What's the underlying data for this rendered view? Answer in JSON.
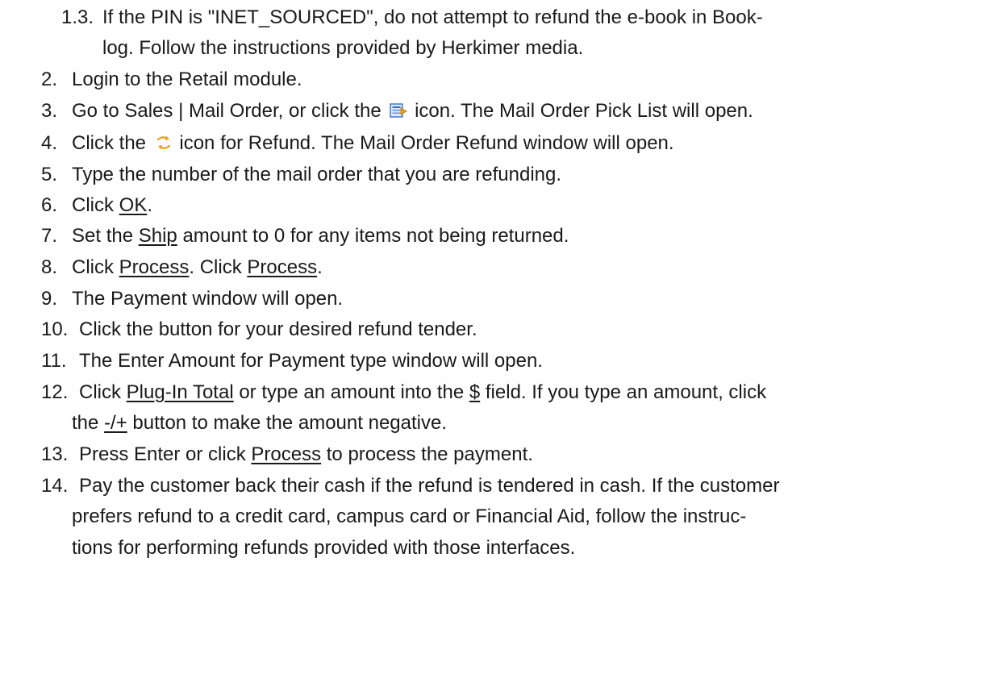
{
  "steps": {
    "s1_3": {
      "number": "1.3.",
      "line1": "If the PIN is \"INET_SOURCED\", do not attempt to refund the e-book in Book-",
      "line2": "log. Follow the instructions provided by Herkimer media."
    },
    "s2": {
      "number": "2.",
      "text": "Login to the Retail module."
    },
    "s3": {
      "number": "3.",
      "before": "Go to Sales | Mail Order, or click the",
      "after": "icon. The Mail Order Pick List will open.",
      "icon": "mail-order-icon"
    },
    "s4": {
      "number": "4.",
      "before": "Click the",
      "after": "icon for Refund. The Mail Order Refund window will open.",
      "icon": "refund-icon"
    },
    "s5": {
      "number": "5.",
      "text": "Type the number of the mail order that you are refunding."
    },
    "s6": {
      "number": "6.",
      "before": "Click",
      "link": "OK",
      "after": "."
    },
    "s7": {
      "number": "7.",
      "before": "Set the",
      "link": "Ship",
      "after": "amount to 0 for any items not being returned."
    },
    "s8": {
      "number": "8.",
      "before": "Click",
      "link1": "Process",
      "middle": ". Click",
      "link2": "Process",
      "after": "."
    },
    "s9": {
      "number": "9.",
      "text": "The Payment window will open."
    },
    "s10": {
      "number": "10.",
      "text": "Click the button for your desired refund tender."
    },
    "s11": {
      "number": "11.",
      "text": "The Enter Amount for Payment type window will open."
    },
    "s12": {
      "number": "12.",
      "before": "Click",
      "link1": "Plug-In Total",
      "middle": "or type an amount into the",
      "link2": "$",
      "after": "field.  If you type an amount, click",
      "line2_before": "the",
      "link3": "-/+",
      "line2_after": "button to make the amount negative."
    },
    "s13": {
      "number": "13.",
      "before": "Press Enter or click",
      "link": "Process",
      "after": "to process the payment."
    },
    "s14": {
      "number": "14.",
      "line1": "Pay the customer back their cash if the refund is tendered in cash. If the customer",
      "line2": "prefers refund to a credit card, campus card or Financial Aid, follow the instruc-",
      "line3": "tions for performing refunds provided with those interfaces."
    }
  },
  "colors": {
    "text": "#1a1a1a",
    "icon_blue": "#3b6fc4",
    "icon_orange": "#e8a317"
  }
}
